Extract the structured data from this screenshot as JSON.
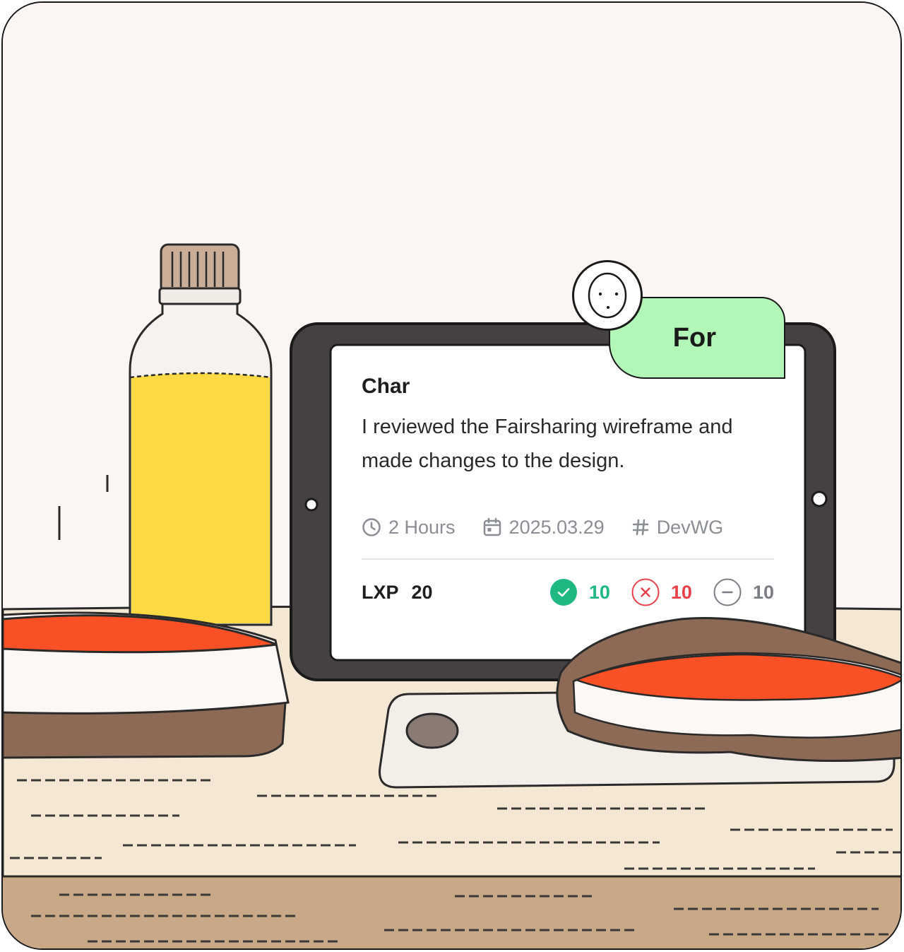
{
  "post": {
    "author": "Char",
    "message": "I reviewed the Fairsharing wireframe and made changes to the design.",
    "stance": "For"
  },
  "meta": {
    "duration": "2 Hours",
    "date": "2025.03.29",
    "tag": "DevWG"
  },
  "footer": {
    "lxp_label": "LXP",
    "lxp_value": "20",
    "votes_for": "10",
    "votes_against": "10",
    "votes_abstain": "10"
  },
  "colors": {
    "stance_bg": "#b2f7b8",
    "for": "#1fb880",
    "against": "#e8414a",
    "abstain": "#7b7e84",
    "meta_text": "#8a8d93"
  },
  "icons": [
    "clock-icon",
    "calendar-icon",
    "hash-icon",
    "check-circle-icon",
    "x-circle-icon",
    "minus-circle-icon"
  ]
}
